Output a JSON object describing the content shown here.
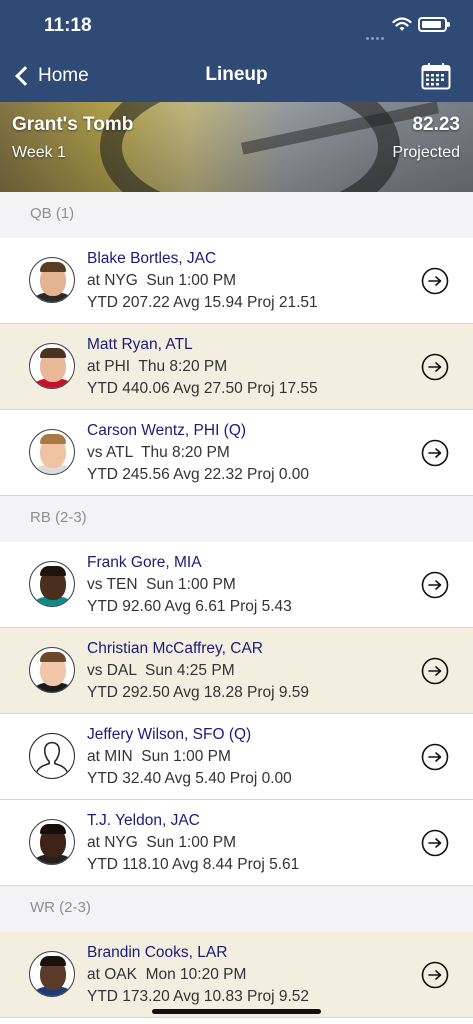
{
  "status_bar": {
    "time": "11:18"
  },
  "nav": {
    "back_label": "Home",
    "title": "Lineup"
  },
  "team": {
    "name": "Grant's Tomb",
    "week": "Week 1",
    "points": "82.23",
    "points_label": "Projected"
  },
  "sections": [
    {
      "label": "QB (1)",
      "players": [
        {
          "name": "Blake Bortles, JAC",
          "game": "at NYG  Sun 1:00 PM",
          "stats": "YTD 207.22 Avg 15.94 Proj 21.51"
        },
        {
          "name": "Matt Ryan, ATL",
          "game": "at PHI  Thu 8:20 PM",
          "stats": "YTD 440.06 Avg 27.50 Proj 17.55"
        },
        {
          "name": "Carson Wentz, PHI (Q)",
          "game": "vs ATL  Thu 8:20 PM",
          "stats": "YTD 245.56 Avg 22.32 Proj 0.00"
        }
      ]
    },
    {
      "label": "RB (2-3)",
      "players": [
        {
          "name": "Frank Gore, MIA",
          "game": "vs TEN  Sun 1:00 PM",
          "stats": "YTD 92.60 Avg 6.61 Proj 5.43"
        },
        {
          "name": "Christian McCaffrey, CAR",
          "game": "vs DAL  Sun 4:25 PM",
          "stats": "YTD 292.50 Avg 18.28 Proj 9.59"
        },
        {
          "name": "Jeffery Wilson, SFO (Q)",
          "game": "at MIN  Sun 1:00 PM",
          "stats": "YTD 32.40 Avg 5.40 Proj 0.00"
        },
        {
          "name": "T.J. Yeldon, JAC",
          "game": "at NYG  Sun 1:00 PM",
          "stats": "YTD 118.10 Avg 8.44 Proj 5.61"
        }
      ]
    },
    {
      "label": "WR (2-3)",
      "players": [
        {
          "name": "Brandin Cooks, LAR",
          "game": "at OAK  Mon 10:20 PM",
          "stats": "YTD 173.20 Avg 10.83 Proj 9.52"
        }
      ]
    }
  ]
}
